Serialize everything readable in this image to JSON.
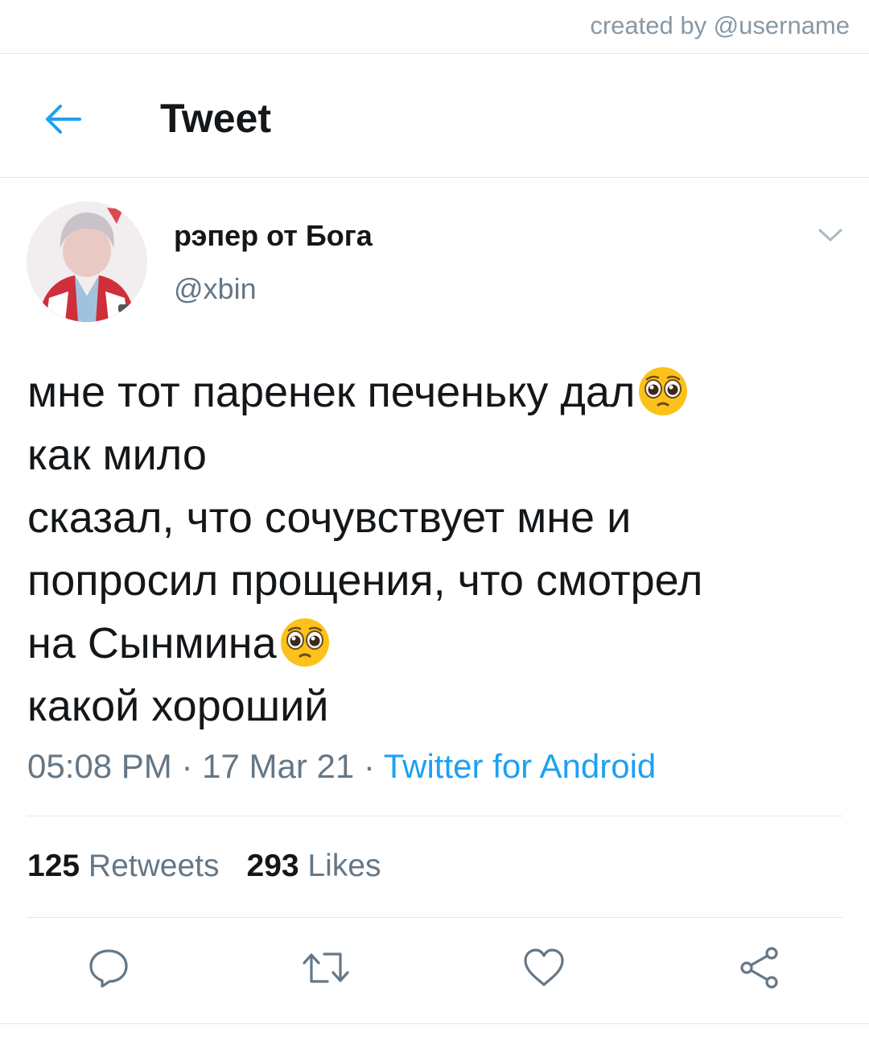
{
  "credit": "created by @username",
  "header": {
    "title": "Tweet",
    "back_icon": "arrow-left-icon"
  },
  "author": {
    "display_name": "рэпер от Бога",
    "handle": "@xbin",
    "avatar": "user-avatar-photo"
  },
  "tweet": {
    "lines": [
      "мне тот паренек печеньку дал",
      "как мило",
      "сказал, что сочувствует мне и",
      "попросил прощения, что смотрел",
      "на Сынмина",
      "какой хороший"
    ],
    "emoji": "pleading-face-emoji",
    "time": "05:08 PM",
    "separator": " · ",
    "date": "17 Mar 21",
    "source": "Twitter for Android"
  },
  "stats": {
    "retweets_count": "125",
    "retweets_label": "Retweets",
    "likes_count": "293",
    "likes_label": "Likes"
  },
  "actions": [
    "reply-icon",
    "retweet-icon",
    "like-icon",
    "share-icon"
  ],
  "colors": {
    "accent": "#1da1f2",
    "text": "#14171a",
    "secondary": "#657786",
    "divider": "#e1e8ed"
  }
}
